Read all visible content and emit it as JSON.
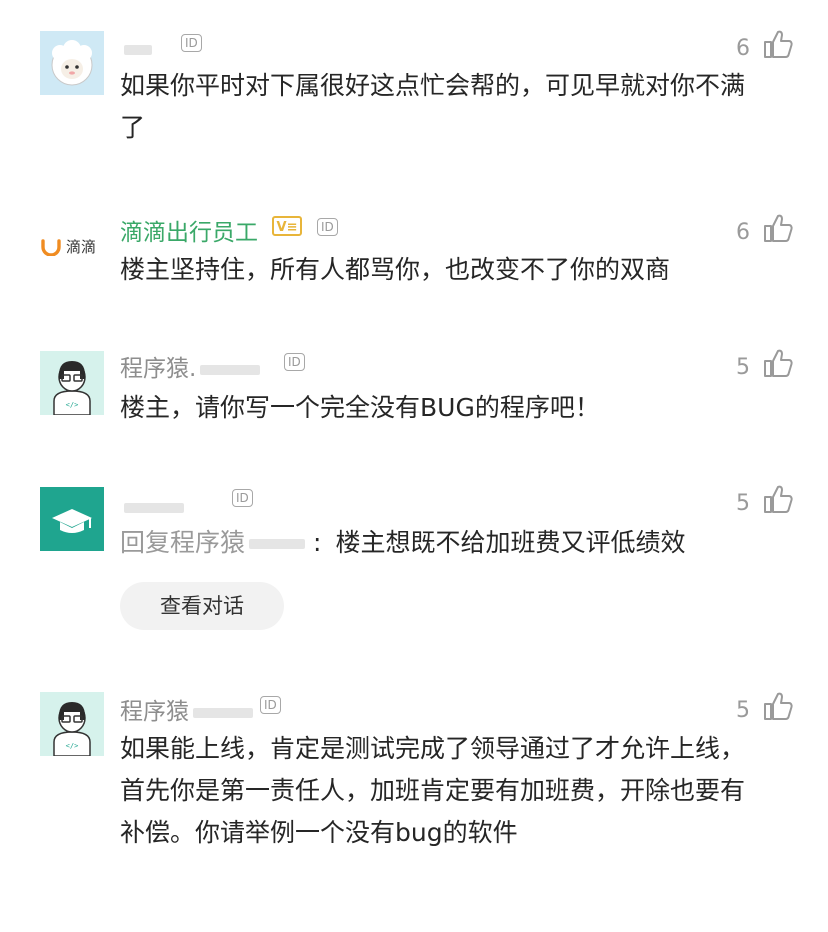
{
  "comments": [
    {
      "username": "",
      "id_tag": "ID",
      "likes": "6",
      "text": "如果你平时对下属很好这点忙会帮的，可见早就对你不满了"
    },
    {
      "avatar_label": "滴滴",
      "username": "滴滴出行员工",
      "badge": "V≡",
      "id_tag": "ID",
      "likes": "6",
      "text": "楼主坚持住，所有人都骂你，也改变不了你的双商"
    },
    {
      "username": "程序猿.",
      "id_tag": "ID",
      "likes": "5",
      "text": "楼主，请你写一个完全没有BUG的程序吧！"
    },
    {
      "username": "",
      "id_tag": "ID",
      "likes": "5",
      "reply_prefix": "回复程序猿",
      "reply_sep": ":",
      "text": "楼主想既不给加班费又评低绩效",
      "view_button": "查看对话"
    },
    {
      "username": "程序猿",
      "id_tag": "ID",
      "likes": "5",
      "text": "如果能上线，肯定是测试完成了领导通过了才允许上线，首先你是第一责任人，加班肯定要有加班费，开除也要有补偿。你请举例一个没有bug的软件"
    }
  ],
  "colors": {
    "accent_green": "#3aa868",
    "badge_gold": "#e8b53a",
    "muted": "#9a9a9a"
  },
  "icons": [
    "sheep-avatar",
    "didi-logo-icon",
    "coder-avatar",
    "graduation-cap-icon",
    "thumbs-up-icon"
  ]
}
